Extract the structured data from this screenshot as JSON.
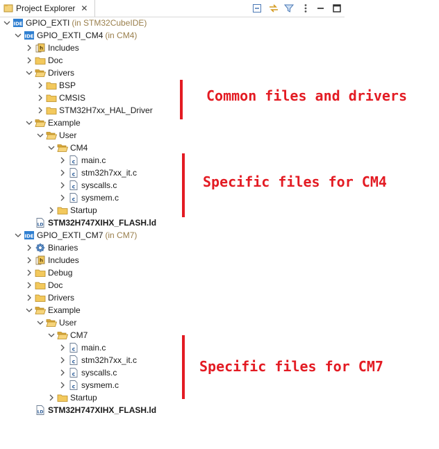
{
  "header": {
    "title": "Project Explorer",
    "close_glyph": "✕",
    "toolbar": [
      {
        "name": "collapse-all-icon"
      },
      {
        "name": "link-with-editor-icon"
      },
      {
        "name": "filter-icon"
      },
      {
        "name": "view-menu-icon"
      },
      {
        "name": "minimize-icon"
      },
      {
        "name": "maximize-icon"
      }
    ]
  },
  "colors": {
    "annotation": "#e31b23",
    "folder": "#e8b74a",
    "decorator": "#9a7f4c"
  },
  "tree": [
    {
      "label": "GPIO_EXTI",
      "decor": "(in STM32CubeIDE)",
      "icon": "ide-project-icon",
      "expanded": true,
      "depth": 0
    },
    {
      "label": "GPIO_EXTI_CM4",
      "decor": "(in CM4)",
      "icon": "ide-project-icon",
      "expanded": true,
      "depth": 1
    },
    {
      "label": "Includes",
      "icon": "includes-icon",
      "expanded": false,
      "depth": 2
    },
    {
      "label": "Doc",
      "icon": "folder-icon",
      "expanded": false,
      "depth": 2
    },
    {
      "label": "Drivers",
      "icon": "folder-open-icon",
      "expanded": true,
      "depth": 2
    },
    {
      "label": "BSP",
      "icon": "folder-icon",
      "expanded": false,
      "depth": 3
    },
    {
      "label": "CMSIS",
      "icon": "folder-icon",
      "expanded": false,
      "depth": 3
    },
    {
      "label": "STM32H7xx_HAL_Driver",
      "icon": "folder-icon",
      "expanded": false,
      "depth": 3
    },
    {
      "label": "Example",
      "icon": "folder-open-icon",
      "expanded": true,
      "depth": 2
    },
    {
      "label": "User",
      "icon": "folder-open-icon",
      "expanded": true,
      "depth": 3
    },
    {
      "label": "CM4",
      "icon": "folder-open-icon",
      "expanded": true,
      "depth": 4
    },
    {
      "label": "main.c",
      "icon": "c-source-icon",
      "expanded": false,
      "depth": 5
    },
    {
      "label": "stm32h7xx_it.c",
      "icon": "c-source-icon",
      "expanded": false,
      "depth": 5
    },
    {
      "label": "syscalls.c",
      "icon": "c-source-icon",
      "expanded": false,
      "depth": 5
    },
    {
      "label": "sysmem.c",
      "icon": "c-source-icon",
      "expanded": false,
      "depth": 5
    },
    {
      "label": "Startup",
      "icon": "folder-icon",
      "expanded": false,
      "depth": 4
    },
    {
      "label": "STM32H747XIHX_FLASH.ld",
      "icon": "linker-script-icon",
      "bold": true,
      "depth": 2
    },
    {
      "label": "GPIO_EXTI_CM7",
      "decor": "(in CM7)",
      "icon": "ide-project-icon",
      "expanded": true,
      "depth": 1
    },
    {
      "label": "Binaries",
      "icon": "binaries-icon",
      "expanded": false,
      "depth": 2
    },
    {
      "label": "Includes",
      "icon": "includes-icon",
      "expanded": false,
      "depth": 2
    },
    {
      "label": "Debug",
      "icon": "folder-icon",
      "expanded": false,
      "depth": 2
    },
    {
      "label": "Doc",
      "icon": "folder-icon",
      "expanded": false,
      "depth": 2
    },
    {
      "label": "Drivers",
      "icon": "folder-icon",
      "expanded": false,
      "depth": 2
    },
    {
      "label": "Example",
      "icon": "folder-open-icon",
      "expanded": true,
      "depth": 2
    },
    {
      "label": "User",
      "icon": "folder-open-icon",
      "expanded": true,
      "depth": 3
    },
    {
      "label": "CM7",
      "icon": "folder-open-icon",
      "expanded": true,
      "depth": 4
    },
    {
      "label": "main.c",
      "icon": "c-source-icon",
      "expanded": false,
      "depth": 5
    },
    {
      "label": "stm32h7xx_it.c",
      "icon": "c-source-icon",
      "expanded": false,
      "depth": 5
    },
    {
      "label": "syscalls.c",
      "icon": "c-source-icon",
      "expanded": false,
      "depth": 5
    },
    {
      "label": "sysmem.c",
      "icon": "c-source-icon",
      "expanded": false,
      "depth": 5
    },
    {
      "label": "Startup",
      "icon": "folder-icon",
      "expanded": false,
      "depth": 4
    },
    {
      "label": "STM32H747XIHX_FLASH.ld",
      "icon": "linker-script-icon",
      "bold": true,
      "depth": 2
    }
  ],
  "annotations": [
    {
      "text": "Common files and drivers"
    },
    {
      "text": "Specific files for CM4"
    },
    {
      "text": "Specific files for CM7"
    }
  ]
}
